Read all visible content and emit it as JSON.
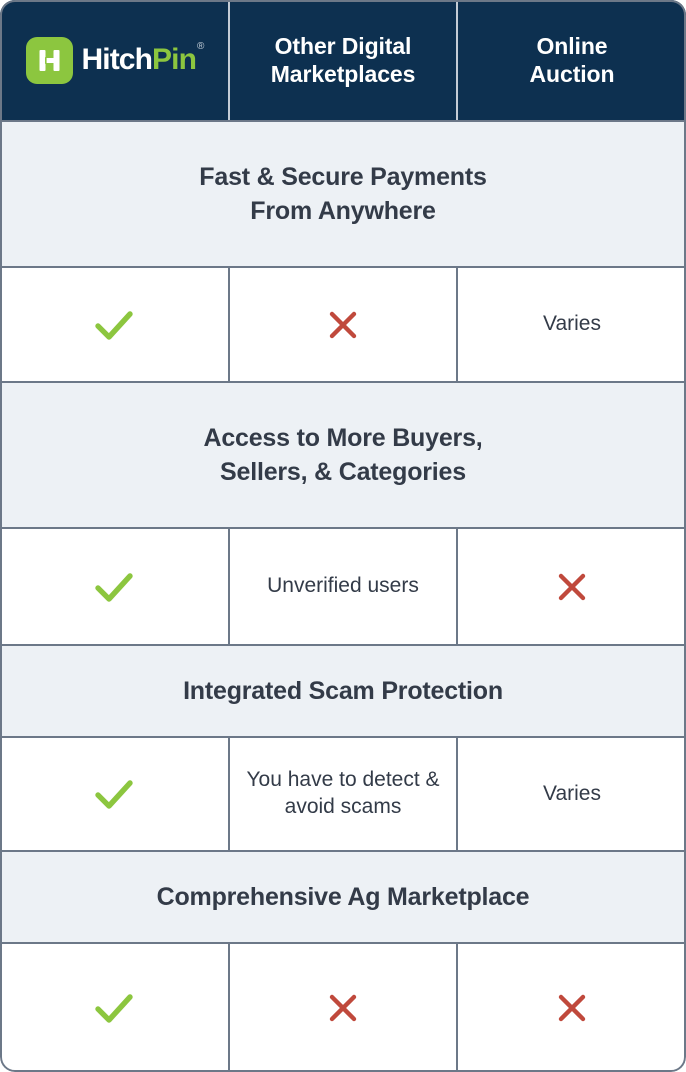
{
  "colors": {
    "header_bg": "#0D3050",
    "section_bg": "#EDF1F5",
    "border": "#6C7888",
    "check_green": "#8CC63F",
    "cross_red": "#C0493C",
    "text_dark": "#333B48",
    "brand_green": "#8CC63F"
  },
  "header": {
    "logo": {
      "mark": "hitchpin-h-monogram",
      "word_primary": "Hitch",
      "word_secondary": "Pin",
      "registered_mark": "®"
    },
    "columns": [
      {
        "label": ""
      },
      {
        "label": "Other Digital\nMarketplaces",
        "line1": "Other Digital",
        "line2": "Marketplaces"
      },
      {
        "label": "Online\nAuction",
        "line1": "Online",
        "line2": "Auction"
      }
    ]
  },
  "features": [
    {
      "title_line1": "Fast & Secure Payments",
      "title_line2": "From Anywhere",
      "title": "Fast & Secure Payments From Anywhere",
      "values": [
        {
          "type": "check",
          "icon": "check-icon",
          "text": ""
        },
        {
          "type": "cross",
          "icon": "cross-icon",
          "text": ""
        },
        {
          "type": "text",
          "icon": "",
          "text": "Varies"
        }
      ]
    },
    {
      "title_line1": "Access to More Buyers,",
      "title_line2": "Sellers, & Categories",
      "title": "Access to More Buyers, Sellers, & Categories",
      "values": [
        {
          "type": "check",
          "icon": "check-icon",
          "text": ""
        },
        {
          "type": "text",
          "icon": "",
          "text": "Unverified users"
        },
        {
          "type": "cross",
          "icon": "cross-icon",
          "text": ""
        }
      ]
    },
    {
      "title_line1": "Integrated Scam Protection",
      "title_line2": "",
      "title": "Integrated Scam Protection",
      "values": [
        {
          "type": "check",
          "icon": "check-icon",
          "text": ""
        },
        {
          "type": "text",
          "icon": "",
          "text": "You have to detect & avoid scams"
        },
        {
          "type": "text",
          "icon": "",
          "text": "Varies"
        }
      ]
    },
    {
      "title_line1": "Comprehensive Ag Marketplace",
      "title_line2": "",
      "title": "Comprehensive Ag Marketplace",
      "values": [
        {
          "type": "check",
          "icon": "check-icon",
          "text": ""
        },
        {
          "type": "cross",
          "icon": "cross-icon",
          "text": ""
        },
        {
          "type": "cross",
          "icon": "cross-icon",
          "text": ""
        }
      ]
    }
  ]
}
